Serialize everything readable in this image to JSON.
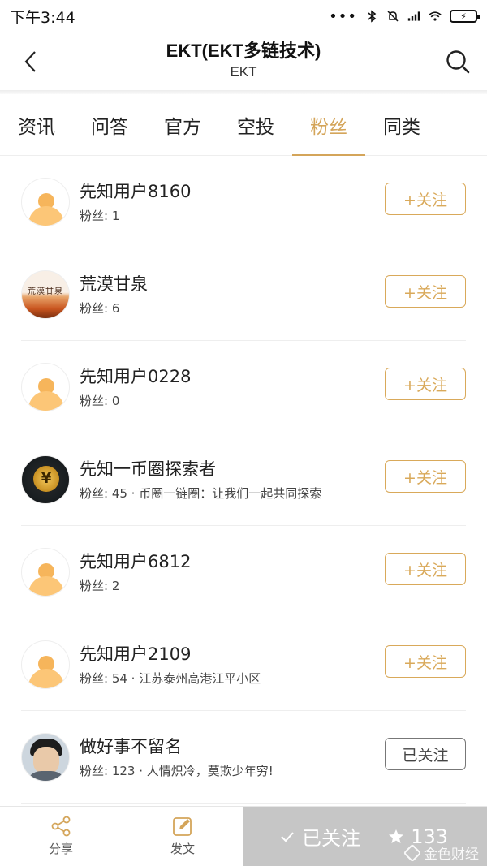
{
  "status_bar": {
    "time": "下午3:44",
    "dots": "•••",
    "battery_label": "⚡"
  },
  "header": {
    "title": "EKT(EKT多链技术)",
    "subtitle": "EKT"
  },
  "tabs": [
    {
      "label": "资讯",
      "active": false
    },
    {
      "label": "问答",
      "active": false
    },
    {
      "label": "官方",
      "active": false
    },
    {
      "label": "空投",
      "active": false
    },
    {
      "label": "粉丝",
      "active": true
    },
    {
      "label": "同类",
      "active": false
    }
  ],
  "fans": [
    {
      "name": "先知用户8160",
      "meta": "粉丝: 1",
      "button": "+关注",
      "avatar": "default-avatar-icon"
    },
    {
      "name": "荒漠甘泉",
      "meta": "粉丝: 6",
      "button": "+关注",
      "avatar": "desert-spring-avatar",
      "avatar_text": "荒漠甘泉"
    },
    {
      "name": "先知用户0228",
      "meta": "粉丝: 0",
      "button": "+关注",
      "avatar": "default-avatar-icon"
    },
    {
      "name": "先知一币圈探索者",
      "meta": "粉丝: 45 · 币圈一链圈：让我们一起共同探索",
      "button": "+关注",
      "avatar": "coin-avatar",
      "avatar_text": "¥"
    },
    {
      "name": "先知用户6812",
      "meta": "粉丝: 2",
      "button": "+关注",
      "avatar": "default-avatar-icon"
    },
    {
      "name": "先知用户2109",
      "meta": "粉丝: 54 · 江苏泰州高港江平小区",
      "button": "+关注",
      "avatar": "default-avatar-icon"
    },
    {
      "name": "做好事不留名",
      "meta": "粉丝: 123 · 人情炽冷，莫欺少年穷!",
      "button": "已关注",
      "avatar": "boy-photo-avatar"
    }
  ],
  "bottom_bar": {
    "share_label": "分享",
    "post_label": "发文",
    "followed_label": "已关注",
    "star_count": "133",
    "watermark": "金色财经"
  },
  "colors": {
    "accent": "#d4a55a",
    "follow_border": "#d9a95a",
    "action_bg": "#c6c6c6"
  }
}
